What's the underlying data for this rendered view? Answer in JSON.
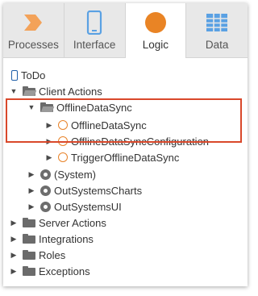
{
  "tabs": [
    {
      "label": "Processes",
      "icon": "processes-chevron-icon",
      "color": "#f3a259"
    },
    {
      "label": "Interface",
      "icon": "phone-icon",
      "color": "#5aa1e3"
    },
    {
      "label": "Logic",
      "icon": "logic-circle-icon",
      "color": "#e98425"
    },
    {
      "label": "Data",
      "icon": "data-grid-icon",
      "color": "#5aa1e3"
    }
  ],
  "active_tab": "Logic",
  "tree": {
    "root": "ToDo",
    "client_actions": {
      "label": "Client Actions",
      "offline_folder": {
        "label": "OfflineDataSync",
        "items": [
          "OfflineDataSync",
          "OfflineDataSyncConfiguration",
          "TriggerOfflineDataSync"
        ]
      },
      "modules": [
        "(System)",
        "OutSystemsCharts",
        "OutSystemsUI"
      ]
    },
    "folders": [
      "Server Actions",
      "Integrations",
      "Roles",
      "Exceptions"
    ]
  },
  "colors": {
    "highlight": "#d9482b",
    "action_icon": "#e8832a",
    "root_icon": "#1f5fa8"
  }
}
